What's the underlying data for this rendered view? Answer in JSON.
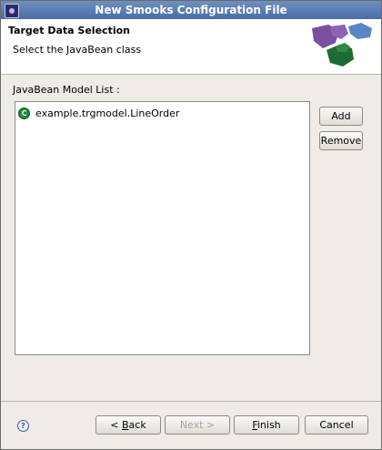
{
  "window": {
    "title": "New Smooks Configuration File"
  },
  "header": {
    "title": "Target Data Selection",
    "subtitle": "Select the JavaBean class"
  },
  "list": {
    "label": "JavaBean Model List :",
    "items": [
      {
        "label": "example.trgmodel.LineOrder",
        "icon": "class-icon"
      }
    ]
  },
  "side_buttons": {
    "add": "Add",
    "remove": "Remove"
  },
  "footer": {
    "back_mnemonic": "B",
    "back_rest": "ack",
    "next": "Next >",
    "finish_mnemonic": "F",
    "finish_rest": "inish",
    "cancel": "Cancel"
  },
  "colors": {
    "titlebar": "#4a6da6",
    "class_icon": "#1e8a3a"
  }
}
